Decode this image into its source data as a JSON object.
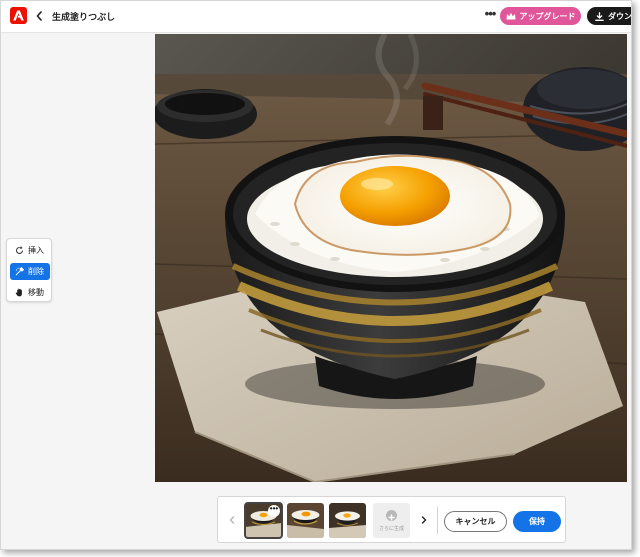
{
  "header": {
    "title": "生成塗りつぶし",
    "upgrade_label": "アップグレード",
    "download_label": "ダウン"
  },
  "tools": [
    {
      "label": "挿入",
      "icon": "insert-icon",
      "active": false
    },
    {
      "label": "削除",
      "icon": "remove-icon",
      "active": true
    },
    {
      "label": "移動",
      "icon": "hand-icon",
      "active": false
    }
  ],
  "bottom_bar": {
    "generate_more_label": "さらに生成",
    "cancel_label": "キャンセル",
    "save_label": "保持"
  },
  "colors": {
    "accent_blue": "#1473e6",
    "upgrade_pink": "#e0569a",
    "brand_red": "#eb1000",
    "download_black": "#1a1a1a"
  }
}
